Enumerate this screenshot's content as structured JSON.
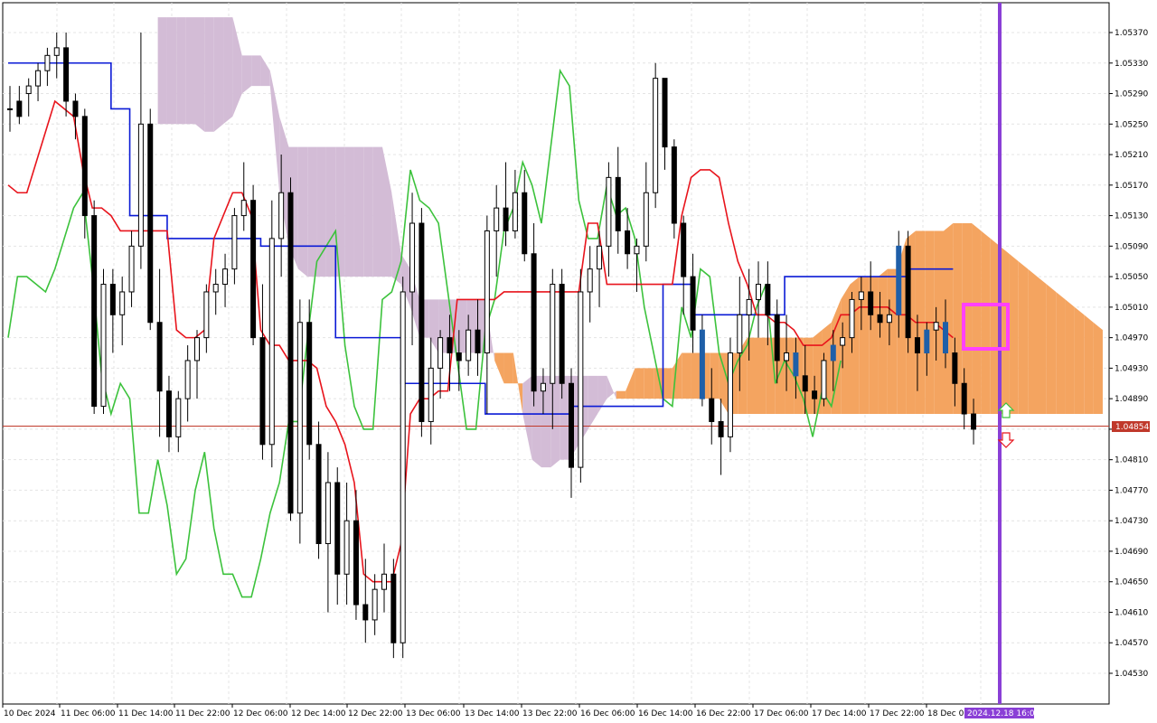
{
  "chart_data": {
    "type": "candlestick",
    "symbol_colors": {
      "background": "#ffffff",
      "grid": "#e4e4e4",
      "bull_body": "#ffffff",
      "bear_body": "#000000",
      "candle_outline": "#000000",
      "highlight_candle": "#1f5fa8",
      "tenkan": "#e8141c",
      "kijun": "#0a1ad6",
      "chikou": "#3cc23c",
      "kumo_bear": "#d3bcd6",
      "kumo_bull": "#f4a460",
      "bid_line": "#c0392b",
      "marker_line": "#8a3fd6",
      "box": "#ff40ff",
      "arrow_up": "#3cc23c",
      "arrow_down": "#e8141c"
    },
    "ylim": [
      1.0451,
      1.0539
    ],
    "yticks": [
      "1.05370",
      "1.05330",
      "1.05290",
      "1.05250",
      "1.05210",
      "1.05170",
      "1.05130",
      "1.05090",
      "1.05050",
      "1.05010",
      "1.04970",
      "1.04930",
      "1.04890",
      "1.04850",
      "1.04810",
      "1.04770",
      "1.04730",
      "1.04690",
      "1.04650",
      "1.04610",
      "1.04570",
      "1.04530"
    ],
    "ytick_values": [
      1.0537,
      1.0533,
      1.0529,
      1.0525,
      1.0521,
      1.0517,
      1.0513,
      1.0509,
      1.0505,
      1.0501,
      1.0497,
      1.0493,
      1.0489,
      1.0485,
      1.0481,
      1.0477,
      1.0473,
      1.0469,
      1.0465,
      1.0461,
      1.0457,
      1.0453
    ],
    "xticks": [
      "10 Dec 2024",
      "11 Dec 06:00",
      "11 Dec 14:00",
      "11 Dec 22:00",
      "12 Dec 06:00",
      "12 Dec 14:00",
      "12 Dec 22:00",
      "13 Dec 06:00",
      "13 Dec 14:00",
      "13 Dec 22:00",
      "16 Dec 06:00",
      "16 Dec 14:00",
      "16 Dec 22:00",
      "17 Dec 06:00",
      "17 Dec 14:00",
      "17 Dec 22:00",
      "18 Dec 06:00"
    ],
    "current_price": "1.04854",
    "current_price_value": 1.04854,
    "marker_time": "2024.12.18 16:00",
    "candles": [
      [
        1.0527,
        1.053,
        1.0524,
        1.0527
      ],
      [
        1.0528,
        1.053,
        1.0525,
        1.0526
      ],
      [
        1.0529,
        1.0531,
        1.0526,
        1.053
      ],
      [
        1.053,
        1.0533,
        1.0528,
        1.0532
      ],
      [
        1.0532,
        1.0535,
        1.053,
        1.0534
      ],
      [
        1.0534,
        1.0537,
        1.0531,
        1.0535
      ],
      [
        1.0535,
        1.0537,
        1.0526,
        1.0528
      ],
      [
        1.0528,
        1.0529,
        1.0523,
        1.0526
      ],
      [
        1.0526,
        1.0527,
        1.051,
        1.0513
      ],
      [
        1.0513,
        1.0515,
        1.0487,
        1.0488
      ],
      [
        1.0488,
        1.0506,
        1.0487,
        1.0504
      ],
      [
        1.0504,
        1.0506,
        1.0495,
        1.05
      ],
      [
        1.05,
        1.0505,
        1.0496,
        1.0503
      ],
      [
        1.0503,
        1.0511,
        1.0501,
        1.0509
      ],
      [
        1.0509,
        1.0537,
        1.0506,
        1.0525
      ],
      [
        1.0525,
        1.0527,
        1.0498,
        1.0499
      ],
      [
        1.0499,
        1.0506,
        1.0484,
        1.049
      ],
      [
        1.049,
        1.0492,
        1.0482,
        1.0484
      ],
      [
        1.0484,
        1.049,
        1.0482,
        1.0489
      ],
      [
        1.0489,
        1.0496,
        1.0486,
        1.0494
      ],
      [
        1.0494,
        1.0498,
        1.0489,
        1.0497
      ],
      [
        1.0497,
        1.0504,
        1.0495,
        1.0503
      ],
      [
        1.0503,
        1.0506,
        1.05,
        1.0504
      ],
      [
        1.0504,
        1.0508,
        1.0501,
        1.0506
      ],
      [
        1.0506,
        1.0514,
        1.0504,
        1.0513
      ],
      [
        1.0513,
        1.052,
        1.0511,
        1.0515
      ],
      [
        1.0515,
        1.0517,
        1.0496,
        1.0497
      ],
      [
        1.0497,
        1.0504,
        1.0481,
        1.0483
      ],
      [
        1.0483,
        1.0515,
        1.048,
        1.051
      ],
      [
        1.051,
        1.0521,
        1.0505,
        1.0516
      ],
      [
        1.0516,
        1.0518,
        1.0473,
        1.0474
      ],
      [
        1.0474,
        1.0502,
        1.047,
        1.0499
      ],
      [
        1.0499,
        1.0502,
        1.0481,
        1.0483
      ],
      [
        1.0483,
        1.0486,
        1.0468,
        1.047
      ],
      [
        1.047,
        1.0482,
        1.0461,
        1.0478
      ],
      [
        1.0478,
        1.048,
        1.0462,
        1.0466
      ],
      [
        1.0466,
        1.0478,
        1.0462,
        1.0473
      ],
      [
        1.0473,
        1.0477,
        1.046,
        1.0462
      ],
      [
        1.0462,
        1.0468,
        1.0457,
        1.046
      ],
      [
        1.046,
        1.0466,
        1.0458,
        1.0464
      ],
      [
        1.0464,
        1.047,
        1.0461,
        1.0466
      ],
      [
        1.0466,
        1.0468,
        1.0455,
        1.0457
      ],
      [
        1.0457,
        1.0505,
        1.0455,
        1.0503
      ],
      [
        1.0503,
        1.0516,
        1.0496,
        1.0512
      ],
      [
        1.0512,
        1.0514,
        1.0484,
        1.0486
      ],
      [
        1.0486,
        1.0497,
        1.0483,
        1.0493
      ],
      [
        1.0493,
        1.0498,
        1.0489,
        1.0497
      ],
      [
        1.0497,
        1.05,
        1.049,
        1.0495
      ],
      [
        1.0495,
        1.0498,
        1.049,
        1.0494
      ],
      [
        1.0494,
        1.05,
        1.0492,
        1.0498
      ],
      [
        1.0498,
        1.0502,
        1.0492,
        1.0495
      ],
      [
        1.0495,
        1.0513,
        1.0487,
        1.0511
      ],
      [
        1.0511,
        1.0517,
        1.0505,
        1.0514
      ],
      [
        1.0514,
        1.052,
        1.0509,
        1.0511
      ],
      [
        1.0511,
        1.0519,
        1.051,
        1.0516
      ],
      [
        1.0516,
        1.0519,
        1.0507,
        1.0508
      ],
      [
        1.0508,
        1.0512,
        1.0488,
        1.049
      ],
      [
        1.049,
        1.0493,
        1.0487,
        1.0491
      ],
      [
        1.0491,
        1.0506,
        1.0485,
        1.0504
      ],
      [
        1.0504,
        1.0506,
        1.0489,
        1.0491
      ],
      [
        1.0491,
        1.0493,
        1.0476,
        1.048
      ],
      [
        1.048,
        1.0506,
        1.0478,
        1.0503
      ],
      [
        1.0503,
        1.0509,
        1.0499,
        1.0506
      ],
      [
        1.0506,
        1.0511,
        1.0501,
        1.0509
      ],
      [
        1.0509,
        1.052,
        1.0505,
        1.0518
      ],
      [
        1.0518,
        1.0522,
        1.0508,
        1.0511
      ],
      [
        1.0511,
        1.0514,
        1.0506,
        1.0508
      ],
      [
        1.0508,
        1.051,
        1.0503,
        1.0509
      ],
      [
        1.0509,
        1.052,
        1.0507,
        1.0516
      ],
      [
        1.0516,
        1.0533,
        1.0514,
        1.0531
      ],
      [
        1.0531,
        1.0531,
        1.0519,
        1.0522
      ],
      [
        1.0522,
        1.0523,
        1.051,
        1.0512
      ],
      [
        1.0512,
        1.0513,
        1.05,
        1.0505
      ],
      [
        1.0505,
        1.0508,
        1.0495,
        1.0498
      ],
      [
        1.0498,
        1.05,
        1.0488,
        1.0489
      ],
      [
        1.0489,
        1.0493,
        1.0483,
        1.0486
      ],
      [
        1.0486,
        1.0489,
        1.0479,
        1.0484
      ],
      [
        1.0484,
        1.0497,
        1.0482,
        1.0495
      ],
      [
        1.0495,
        1.0505,
        1.049,
        1.05
      ],
      [
        1.05,
        1.0506,
        1.0494,
        1.0502
      ],
      [
        1.0502,
        1.0507,
        1.0497,
        1.0504
      ],
      [
        1.0504,
        1.0507,
        1.0496,
        1.05
      ],
      [
        1.05,
        1.0502,
        1.0491,
        1.0494
      ],
      [
        1.0494,
        1.05,
        1.049,
        1.0495
      ],
      [
        1.0495,
        1.0497,
        1.0489,
        1.0492
      ],
      [
        1.0492,
        1.0496,
        1.0487,
        1.049
      ],
      [
        1.049,
        1.0492,
        1.0487,
        1.0489
      ],
      [
        1.0489,
        1.0495,
        1.0488,
        1.0494
      ],
      [
        1.0494,
        1.0498,
        1.049,
        1.0496
      ],
      [
        1.0496,
        1.0499,
        1.0493,
        1.0497
      ],
      [
        1.0497,
        1.0503,
        1.0495,
        1.0502
      ],
      [
        1.0502,
        1.0505,
        1.0498,
        1.0503
      ],
      [
        1.0503,
        1.0507,
        1.0498,
        1.05
      ],
      [
        1.05,
        1.0503,
        1.0497,
        1.0499
      ],
      [
        1.0499,
        1.0502,
        1.0496,
        1.05
      ],
      [
        1.05,
        1.0511,
        1.0497,
        1.0509
      ],
      [
        1.0509,
        1.0511,
        1.0495,
        1.0497
      ],
      [
        1.0497,
        1.05,
        1.049,
        1.0495
      ],
      [
        1.0495,
        1.0499,
        1.0492,
        1.0498
      ],
      [
        1.0498,
        1.0501,
        1.0494,
        1.0499
      ],
      [
        1.0499,
        1.0502,
        1.0493,
        1.0495
      ],
      [
        1.0495,
        1.0497,
        1.0488,
        1.0491
      ],
      [
        1.0491,
        1.0493,
        1.0485,
        1.0487
      ],
      [
        1.0487,
        1.0489,
        1.0483,
        1.0485
      ]
    ],
    "highlight_candles": [
      74,
      84,
      88,
      95,
      98,
      100
    ],
    "tenkan": [
      1.0517,
      1.0516,
      1.0516,
      1.052,
      1.0524,
      1.0528,
      1.0527,
      1.0526,
      1.0519,
      1.0514,
      1.0514,
      1.0513,
      1.0511,
      1.0511,
      1.0511,
      1.0511,
      1.0511,
      1.0511,
      1.0498,
      1.0497,
      1.0497,
      1.0498,
      1.051,
      1.0513,
      1.0516,
      1.0516,
      1.0513,
      1.0498,
      1.0496,
      1.0496,
      1.0494,
      1.0494,
      1.0494,
      1.0493,
      1.0488,
      1.0486,
      1.0483,
      1.0478,
      1.0466,
      1.0465,
      1.0465,
      1.0465,
      1.047,
      1.0487,
      1.0489,
      1.0489,
      1.049,
      1.049,
      1.0502,
      1.0502,
      1.0502,
      1.0502,
      1.0502,
      1.0503,
      1.0503,
      1.0503,
      1.0503,
      1.0503,
      1.0503,
      1.0503,
      1.0503,
      1.0503,
      1.0512,
      1.0512,
      1.0504,
      1.0504,
      1.0504,
      1.0504,
      1.0504,
      1.0504,
      1.0504,
      1.0504,
      1.0513,
      1.0518,
      1.0519,
      1.0519,
      1.0518,
      1.0512,
      1.0507,
      1.0504,
      1.05,
      1.05,
      1.0499,
      1.0499,
      1.0498,
      1.0496,
      1.0496,
      1.0496,
      1.0497,
      1.05,
      1.05,
      1.0501,
      1.0501,
      1.0501,
      1.0501,
      1.05,
      1.05,
      1.0499,
      1.0499,
      1.0499,
      1.0498,
      1.0497
    ],
    "kijun": [
      1.0533,
      1.0533,
      1.0533,
      1.0533,
      1.0533,
      1.0533,
      1.0533,
      1.0533,
      1.0533,
      1.0533,
      1.0533,
      1.0527,
      1.0527,
      1.0513,
      1.0513,
      1.0513,
      1.0513,
      1.051,
      1.051,
      1.051,
      1.051,
      1.051,
      1.051,
      1.051,
      1.051,
      1.051,
      1.051,
      1.0509,
      1.0509,
      1.0509,
      1.0509,
      1.0509,
      1.0509,
      1.0509,
      1.0509,
      1.0497,
      1.0497,
      1.0497,
      1.0497,
      1.0497,
      1.0497,
      1.0497,
      1.0491,
      1.0491,
      1.0491,
      1.0491,
      1.0491,
      1.0491,
      1.0491,
      1.0491,
      1.0491,
      1.0487,
      1.0487,
      1.0487,
      1.0487,
      1.0487,
      1.0487,
      1.0487,
      1.0487,
      1.0487,
      1.0488,
      1.0488,
      1.0488,
      1.0488,
      1.0488,
      1.0488,
      1.0488,
      1.0488,
      1.0488,
      1.0488,
      1.0504,
      1.0504,
      1.0504,
      1.05,
      1.05,
      1.05,
      1.05,
      1.05,
      1.05,
      1.05,
      1.05,
      1.05,
      1.05,
      1.0505,
      1.0505,
      1.0505,
      1.0505,
      1.0505,
      1.0505,
      1.0505,
      1.0505,
      1.0505,
      1.0505,
      1.0505,
      1.0505,
      1.0505,
      1.0506,
      1.0506,
      1.0506,
      1.0506,
      1.0506,
      1.0506
    ],
    "chikou": [
      1.0497,
      1.0505,
      1.0505,
      1.0504,
      1.0503,
      1.0506,
      1.051,
      1.0514,
      1.0516,
      1.0505,
      1.0492,
      1.0487,
      1.0491,
      1.0489,
      1.0474,
      1.0474,
      1.0481,
      1.0475,
      1.0466,
      1.0468,
      1.0477,
      1.0482,
      1.0472,
      1.0466,
      1.0466,
      1.0463,
      1.0463,
      1.0468,
      1.0474,
      1.0478,
      1.0486,
      1.0486,
      1.0497,
      1.0507,
      1.0509,
      1.0511,
      1.0496,
      1.0488,
      1.0485,
      1.0485,
      1.0502,
      1.0503,
      1.0507,
      1.0519,
      1.0515,
      1.0514,
      1.0512,
      1.0503,
      1.0494,
      1.0485,
      1.0485,
      1.0498,
      1.0502,
      1.0511,
      1.0514,
      1.052,
      1.0517,
      1.0512,
      1.0522,
      1.0532,
      1.053,
      1.0515,
      1.051,
      1.051,
      1.0517,
      1.0513,
      1.0514,
      1.051,
      1.0501,
      1.0495,
      1.0489,
      1.0488,
      1.0501,
      1.0497,
      1.0506,
      1.0505,
      1.0495,
      1.0491,
      1.0494,
      1.0496,
      1.0501,
      1.0504,
      1.0491,
      1.0494,
      1.0492,
      1.0489,
      1.0484,
      1.049,
      1.0488,
      1.0494
    ],
    "kumo_future": [
      [
        1.0539,
        1.0525
      ],
      [
        1.0539,
        1.0525
      ],
      [
        1.0539,
        1.0525
      ],
      [
        1.0539,
        1.0525
      ],
      [
        1.0539,
        1.0525
      ],
      [
        1.0539,
        1.0524
      ],
      [
        1.0539,
        1.0524
      ],
      [
        1.0539,
        1.0525
      ],
      [
        1.0539,
        1.0526
      ],
      [
        1.0534,
        1.0529
      ],
      [
        1.0534,
        1.053
      ],
      [
        1.0534,
        1.053
      ],
      [
        1.0532,
        1.053
      ],
      [
        1.0526,
        1.0516
      ],
      [
        1.0522,
        1.0509
      ],
      [
        1.0522,
        1.0506
      ],
      [
        1.0522,
        1.0505
      ],
      [
        1.0522,
        1.0505
      ],
      [
        1.0522,
        1.0505
      ],
      [
        1.0522,
        1.0505
      ],
      [
        1.0522,
        1.0505
      ],
      [
        1.0522,
        1.0505
      ],
      [
        1.0522,
        1.0505
      ],
      [
        1.0522,
        1.0505
      ],
      [
        1.0522,
        1.0505
      ],
      [
        1.0516,
        1.0505
      ],
      [
        1.0508,
        1.0504
      ],
      [
        1.0506,
        1.0501
      ],
      [
        1.0502,
        1.0497
      ],
      [
        1.0502,
        1.0497
      ],
      [
        1.0502,
        1.0495
      ],
      [
        1.0502,
        1.0495
      ],
      [
        1.0502,
        1.0495
      ],
      [
        1.0502,
        1.0495
      ],
      [
        1.0502,
        1.0495
      ],
      [
        1.0502,
        1.0495
      ],
      [
        1.0494,
        1.0495
      ],
      [
        1.0491,
        1.0495
      ],
      [
        1.0491,
        1.0495
      ],
      [
        1.0491,
        1.0487
      ],
      [
        1.0492,
        1.0481
      ],
      [
        1.0492,
        1.048
      ],
      [
        1.0492,
        1.048
      ],
      [
        1.0492,
        1.0481
      ],
      [
        1.0492,
        1.0481
      ],
      [
        1.0492,
        1.0483
      ],
      [
        1.0492,
        1.0485
      ],
      [
        1.0492,
        1.0487
      ],
      [
        1.0492,
        1.0489
      ],
      [
        1.0489,
        1.049
      ],
      [
        1.0489,
        1.049
      ],
      [
        1.0489,
        1.0493
      ],
      [
        1.0489,
        1.0493
      ],
      [
        1.0489,
        1.0493
      ],
      [
        1.0489,
        1.0493
      ],
      [
        1.0489,
        1.0493
      ],
      [
        1.0489,
        1.0495
      ],
      [
        1.0489,
        1.0495
      ],
      [
        1.0489,
        1.0495
      ],
      [
        1.0489,
        1.0495
      ],
      [
        1.0489,
        1.0495
      ],
      [
        1.0487,
        1.0495
      ],
      [
        1.0487,
        1.0495
      ],
      [
        1.0487,
        1.0497
      ],
      [
        1.0487,
        1.0497
      ],
      [
        1.0487,
        1.0497
      ],
      [
        1.0487,
        1.0497
      ],
      [
        1.0487,
        1.0497
      ],
      [
        1.0487,
        1.0497
      ],
      [
        1.0487,
        1.0497
      ],
      [
        1.0487,
        1.0497
      ],
      [
        1.0487,
        1.0498
      ],
      [
        1.0487,
        1.0499
      ],
      [
        1.0487,
        1.0502
      ],
      [
        1.0487,
        1.0504
      ],
      [
        1.0487,
        1.0505
      ],
      [
        1.0487,
        1.0505
      ],
      [
        1.0487,
        1.0505
      ],
      [
        1.0487,
        1.0506
      ],
      [
        1.0487,
        1.0506
      ],
      [
        1.0487,
        1.051
      ],
      [
        1.0487,
        1.0511
      ],
      [
        1.0487,
        1.0511
      ],
      [
        1.0487,
        1.0511
      ],
      [
        1.0487,
        1.0511
      ],
      [
        1.0487,
        1.0512
      ],
      [
        1.0487,
        1.0512
      ],
      [
        1.0487,
        1.0512
      ],
      [
        1.0487,
        1.0511
      ],
      [
        1.0487,
        1.051
      ],
      [
        1.0487,
        1.0509
      ],
      [
        1.0487,
        1.0508
      ],
      [
        1.0487,
        1.0507
      ],
      [
        1.0487,
        1.0506
      ],
      [
        1.0487,
        1.0505
      ],
      [
        1.0487,
        1.0504
      ],
      [
        1.0487,
        1.0503
      ],
      [
        1.0487,
        1.0502
      ],
      [
        1.0487,
        1.0501
      ],
      [
        1.0487,
        1.05
      ],
      [
        1.0487,
        1.0499
      ],
      [
        1.0487,
        1.0498
      ],
      [
        1.0487,
        1.0497
      ],
      [
        1.0487,
        1.0496
      ],
      [
        1.0487,
        1.05
      ],
      [
        1.0487,
        1.05
      ],
      [
        1.0505,
        1.05
      ],
      [
        1.0505,
        1.05
      ],
      [
        1.0506,
        1.05
      ],
      [
        1.0506,
        1.0502
      ],
      [
        1.0506,
        1.0503
      ],
      [
        1.0506,
        1.0503
      ],
      [
        1.0506,
        1.0503
      ],
      [
        1.0506,
        1.0503
      ],
      [
        1.0506,
        1.0502
      ],
      [
        1.0506,
        1.0501
      ]
    ]
  }
}
